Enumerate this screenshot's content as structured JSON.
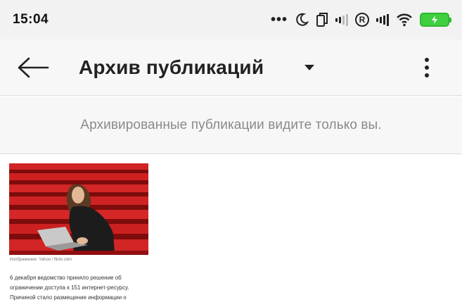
{
  "status_bar": {
    "time": "15:04",
    "dots": "•••",
    "icons": [
      "moon-icon",
      "dual-sim-icon",
      "signal-weak-icon",
      "registered-icon",
      "signal-icon",
      "wifi-icon",
      "battery-charging-icon"
    ],
    "battery_color": "#3fcf3f"
  },
  "app_bar": {
    "title": "Архив публикаций",
    "back_icon": "arrow-left-icon",
    "dropdown_icon": "caret-down-icon",
    "more_icon": "more-vert-icon"
  },
  "notice": {
    "text": "Архивированные публикации видите только вы."
  },
  "posts": [
    {
      "photo_icon": "woman-laptop-photo",
      "caption": "Изображение: Yahoo / flickr.com",
      "lines": [
        "6 декабря ведомство приняло решение об",
        "ограничении доступа к 151 интернет-ресурсу.",
        "Причиной стало размещение информации о"
      ]
    }
  ],
  "colors": {
    "status_bg": "#f2f2f2",
    "app_bar_bg": "#f7f7f7",
    "notice_text": "#8a8a8a",
    "photo_red": "#c01818"
  }
}
